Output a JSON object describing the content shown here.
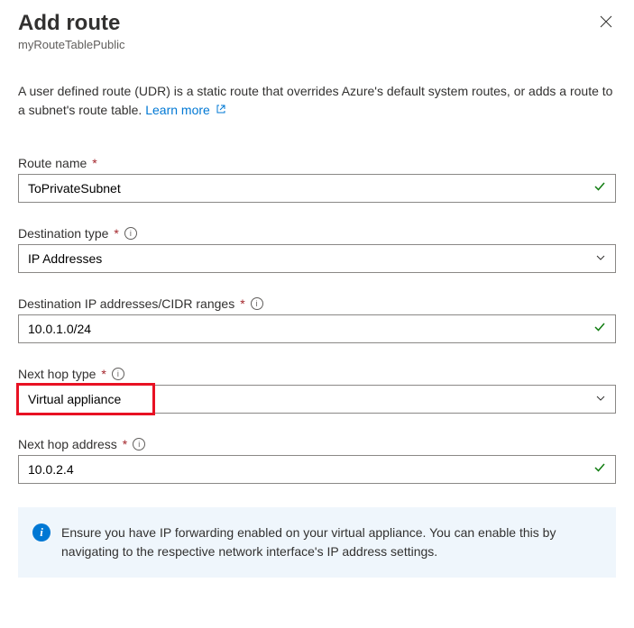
{
  "header": {
    "title": "Add route",
    "subtitle": "myRouteTablePublic"
  },
  "description": {
    "text": "A user defined route (UDR) is a static route that overrides Azure's default system routes, or adds a route to a subnet's route table. ",
    "learn_more": "Learn more"
  },
  "fields": {
    "route_name": {
      "label": "Route name",
      "value": "ToPrivateSubnet"
    },
    "dest_type": {
      "label": "Destination type",
      "value": "IP Addresses"
    },
    "dest_ip": {
      "label": "Destination IP addresses/CIDR ranges",
      "value": "10.0.1.0/24"
    },
    "next_hop_type": {
      "label": "Next hop type",
      "value": "Virtual appliance"
    },
    "next_hop_addr": {
      "label": "Next hop address",
      "value": "10.0.2.4"
    }
  },
  "callout": {
    "text": "Ensure you have IP forwarding enabled on your virtual appliance. You can enable this by navigating to the respective network interface's IP address settings."
  }
}
